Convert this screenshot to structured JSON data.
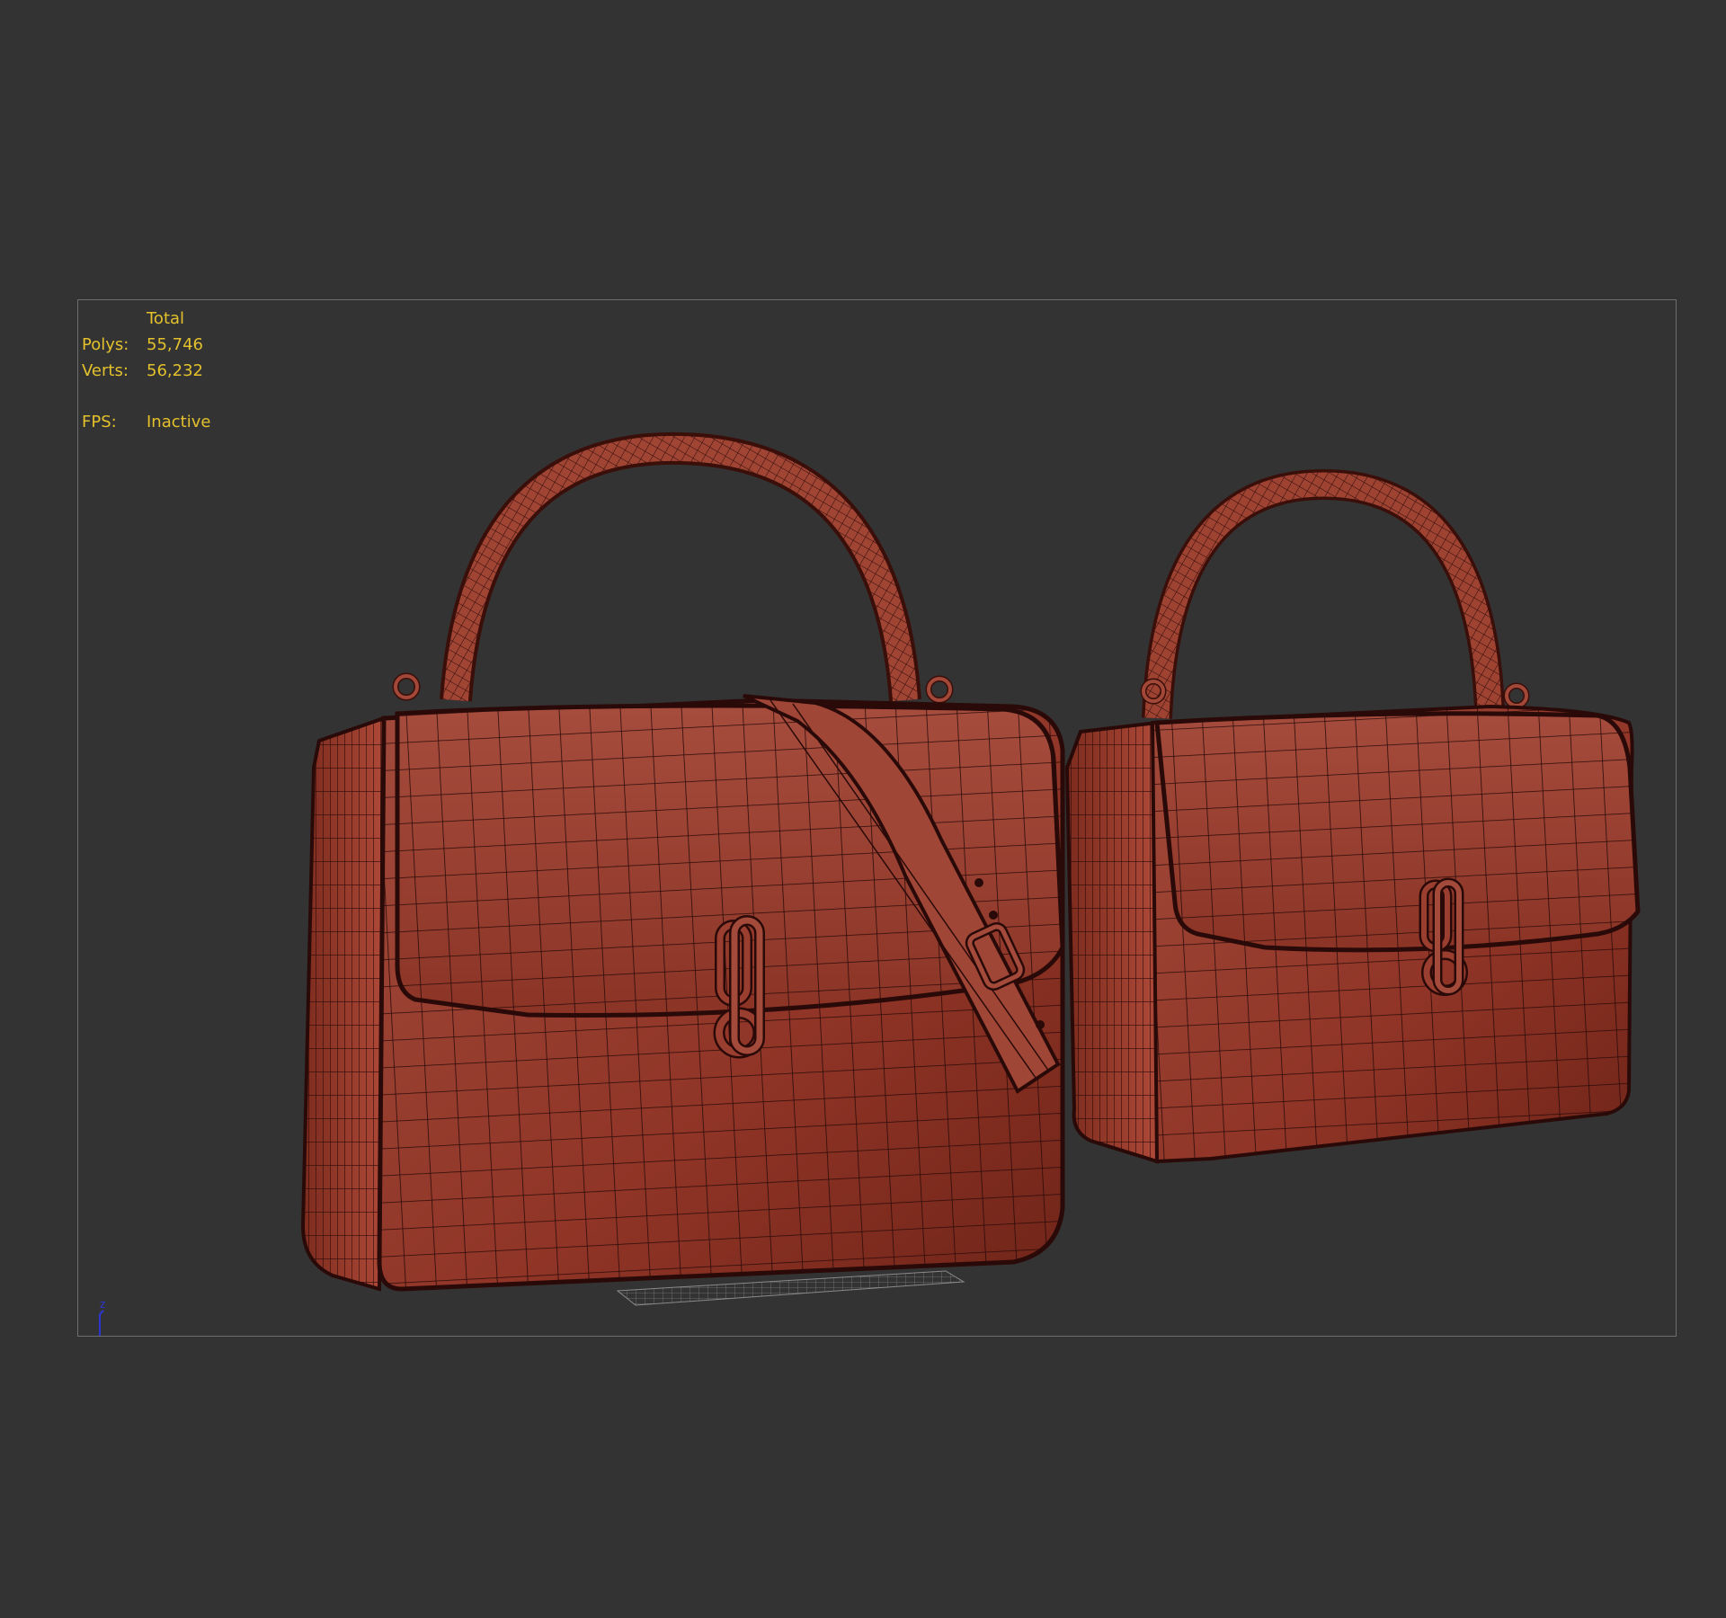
{
  "stats": {
    "header": "Total",
    "polys_label": "Polys:",
    "polys_value": "55,746",
    "verts_label": "Verts:",
    "verts_value": "56,232",
    "fps_label": "FPS:",
    "fps_value": "Inactive"
  },
  "axis": {
    "z_label": "z"
  },
  "colors": {
    "background": "#333333",
    "viewport_border": "#6e6e6e",
    "stats_text": "#e3c12c",
    "bag_fill": "#9a3a2c",
    "wire": "#2a0a08",
    "axis_z": "#2d35d4"
  },
  "scene": {
    "objects": [
      "handbag-large",
      "handbag-small",
      "ground-grid"
    ]
  }
}
